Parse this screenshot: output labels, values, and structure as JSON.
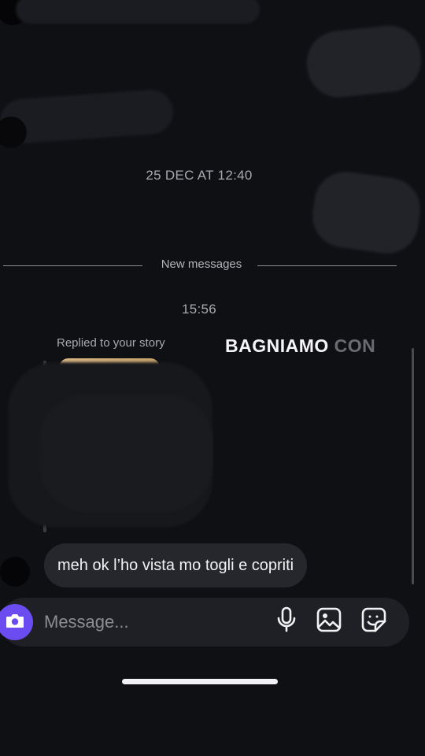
{
  "thread": {
    "timestamp_1": "25 DEC AT 12:40",
    "new_messages_label": "New messages",
    "timestamp_2": "15:56"
  },
  "story_reply": {
    "label": "Replied to your story",
    "story_text_word1": "BAGNIAMO",
    "story_text_word2": "CON"
  },
  "message": {
    "text": "meh ok l’ho vista mo togli e copriti"
  },
  "composer": {
    "placeholder": "Message...",
    "icons": [
      "camera-icon",
      "microphone-icon",
      "gallery-icon",
      "sticker-icon"
    ],
    "camera_color": "#6a4cf0"
  }
}
